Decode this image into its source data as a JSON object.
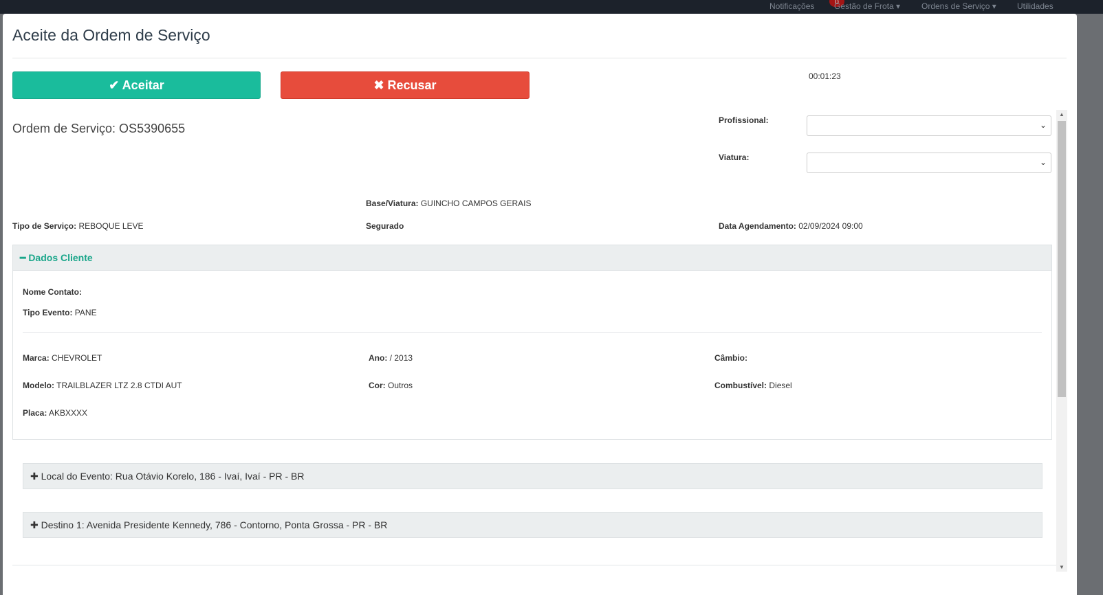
{
  "nav": {
    "notifications": "Notificações",
    "badge": "0",
    "fleet": "Gestão de Frota ▾",
    "orders": "Ordens de Serviço ▾",
    "utilities": "Utilidades"
  },
  "modal": {
    "title": "Aceite da Ordem de Serviço",
    "accept": "✔ Aceitar",
    "refuse": "✖ Recusar",
    "timer": "00:01:23",
    "os": "Ordem de Serviço: OS5390655",
    "profissional_label": "Profissional:",
    "viatura_label": "Viatura:",
    "profissional_value": "",
    "viatura_value": "",
    "base_label": "Base/Viatura:",
    "base": "GUINCHO CAMPOS GERAIS",
    "tipo_label": "Tipo de Serviço:",
    "tipo": "REBOQUE LEVE",
    "segurado_label": "Segurado",
    "agend_label": "Data Agendamento:",
    "agend": "02/09/2024 09:00",
    "colors": {
      "accept": "#1abc9c",
      "refuse": "#e74c3c"
    }
  },
  "cliente": {
    "header": "━ Dados Cliente",
    "nome_label": "Nome Contato:",
    "nome": "",
    "evento_label": "Tipo Evento:",
    "evento": "PANE",
    "marca_label": "Marca:",
    "marca": "CHEVROLET",
    "ano_label": "Ano:",
    "ano": "/ 2013",
    "cambio_label": "Câmbio:",
    "cambio": "",
    "modelo_label": "Modelo:",
    "modelo": "TRAILBLAZER LTZ 2.8 CTDI AUT",
    "cor_label": "Cor:",
    "cor": "Outros",
    "comb_label": "Combustível:",
    "comb": "Diesel",
    "placa_label": "Placa:",
    "placa": "AKBXXXX"
  },
  "local": "✚ Local do Evento: Rua Otávio Korelo, 186 - Ivaí, Ivaí - PR - BR",
  "destino": "✚ Destino 1: Avenida Presidente Kennedy, 786 - Contorno, Ponta Grossa - PR - BR"
}
